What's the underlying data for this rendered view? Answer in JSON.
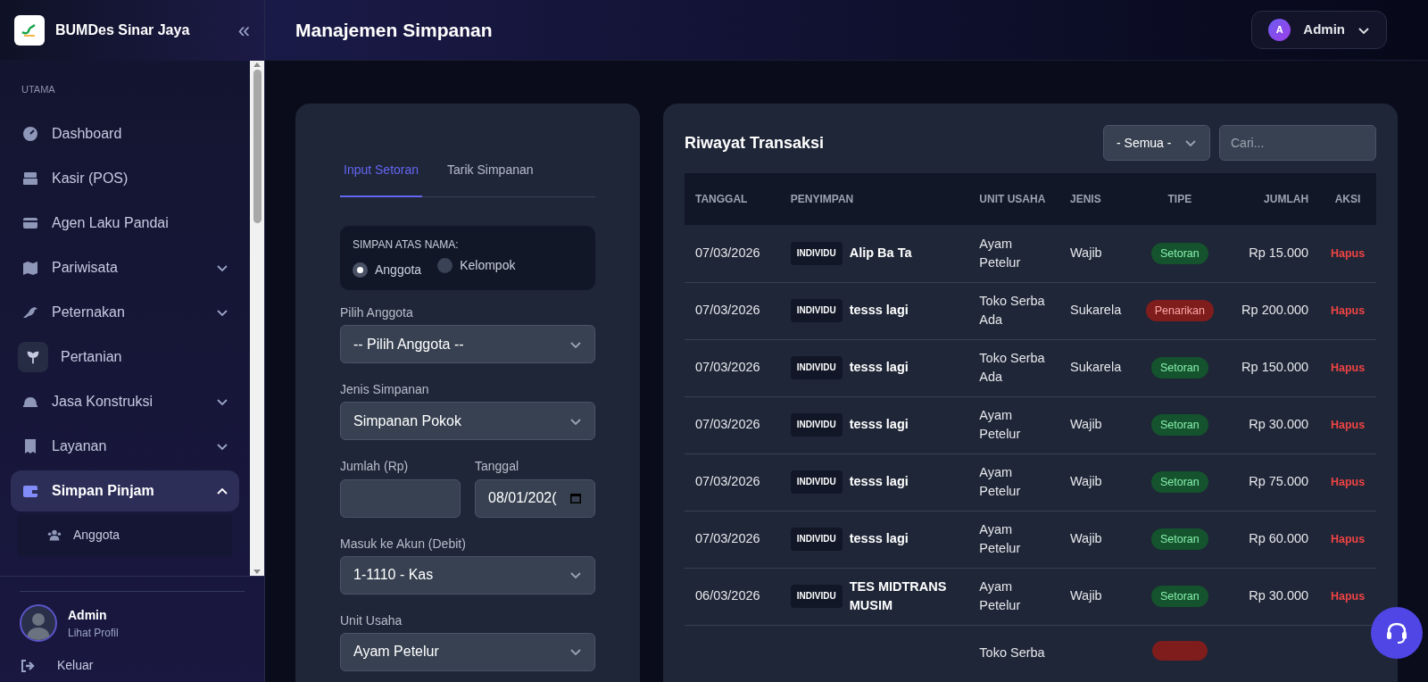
{
  "brand": {
    "name": "BUMDes Sinar Jaya",
    "collapse": "«"
  },
  "sidebar": {
    "section": "UTAMA",
    "items": [
      {
        "label": "Dashboard",
        "kind": "link",
        "selected": false
      },
      {
        "label": "Kasir (POS)",
        "kind": "link",
        "selected": false
      },
      {
        "label": "Agen Laku Pandai",
        "kind": "link",
        "selected": false
      },
      {
        "label": "Pariwisata",
        "kind": "group",
        "expanded": false,
        "selected": false
      },
      {
        "label": "Peternakan",
        "kind": "group",
        "expanded": false,
        "selected": false
      },
      {
        "label": "Pertanian",
        "kind": "boxed",
        "selected": false
      },
      {
        "label": "Jasa Konstruksi",
        "kind": "group",
        "expanded": false,
        "selected": false
      },
      {
        "label": "Layanan",
        "kind": "group",
        "expanded": false,
        "selected": false
      },
      {
        "label": "Simpan Pinjam",
        "kind": "group",
        "expanded": true,
        "selected": true,
        "children": [
          {
            "label": "Anggota"
          }
        ]
      }
    ],
    "user": {
      "name": "Admin",
      "link": "Lihat Profil"
    },
    "logout": "Keluar"
  },
  "header": {
    "title": "Manajemen Simpanan",
    "user": {
      "initial": "A",
      "name": "Admin"
    }
  },
  "form": {
    "tabs": [
      {
        "label": "Input Setoran",
        "selected": true
      },
      {
        "label": "Tarik Simpanan",
        "selected": false
      }
    ],
    "owner": {
      "title": "SIMPAN ATAS NAMA:",
      "options": [
        {
          "label": "Anggota",
          "selected": true
        },
        {
          "label": "Kelompok",
          "selected": false
        }
      ]
    },
    "fields": [
      {
        "label": "Pilih Anggota",
        "kind": "select",
        "value": "-- Pilih Anggota --"
      },
      {
        "label": "Jenis Simpanan",
        "kind": "select",
        "value": "Simpanan Pokok"
      },
      {
        "kind": "pair",
        "items": [
          {
            "label": "Jumlah (Rp)",
            "kind": "text"
          },
          {
            "label": "Tanggal",
            "kind": "date",
            "value": "08/01/202("
          }
        ]
      },
      {
        "label": "Masuk ke Akun (Debit)",
        "kind": "select",
        "value": "1-1110 - Kas"
      },
      {
        "label": "Unit Usaha",
        "kind": "select",
        "value": "Ayam Petelur"
      }
    ]
  },
  "history": {
    "title": "Riwayat Transaksi",
    "filter": "- Semua -",
    "search": {
      "placeholder": "Cari..."
    },
    "table": {
      "columns": [
        "TANGGAL",
        "PENYIMPAN",
        "UNIT USAHA",
        "JENIS",
        "TIPE",
        "JUMLAH",
        "AKSI"
      ],
      "rows": [
        {
          "tanggal": "07/03/2026",
          "badge": "INDIVIDU",
          "penyimpan": "Alip Ba Ta",
          "unit": "Ayam Petelur",
          "jenis": "Wajib",
          "tipe": {
            "label": "Setoran",
            "kind": "setoran"
          },
          "jumlah": "Rp 15.000",
          "aksi": "Hapus"
        },
        {
          "tanggal": "07/03/2026",
          "badge": "INDIVIDU",
          "penyimpan": "tesss lagi",
          "unit": "Toko Serba Ada",
          "jenis": "Sukarela",
          "tipe": {
            "label": "Penarikan",
            "kind": "penarikan"
          },
          "jumlah": "Rp 200.000",
          "aksi": "Hapus"
        },
        {
          "tanggal": "07/03/2026",
          "badge": "INDIVIDU",
          "penyimpan": "tesss lagi",
          "unit": "Toko Serba Ada",
          "jenis": "Sukarela",
          "tipe": {
            "label": "Setoran",
            "kind": "setoran"
          },
          "jumlah": "Rp 150.000",
          "aksi": "Hapus"
        },
        {
          "tanggal": "07/03/2026",
          "badge": "INDIVIDU",
          "penyimpan": "tesss lagi",
          "unit": "Ayam Petelur",
          "jenis": "Wajib",
          "tipe": {
            "label": "Setoran",
            "kind": "setoran"
          },
          "jumlah": "Rp 30.000",
          "aksi": "Hapus"
        },
        {
          "tanggal": "07/03/2026",
          "badge": "INDIVIDU",
          "penyimpan": "tesss lagi",
          "unit": "Ayam Petelur",
          "jenis": "Wajib",
          "tipe": {
            "label": "Setoran",
            "kind": "setoran"
          },
          "jumlah": "Rp 75.000",
          "aksi": "Hapus"
        },
        {
          "tanggal": "07/03/2026",
          "badge": "INDIVIDU",
          "penyimpan": "tesss lagi",
          "unit": "Ayam Petelur",
          "jenis": "Wajib",
          "tipe": {
            "label": "Setoran",
            "kind": "setoran"
          },
          "jumlah": "Rp 60.000",
          "aksi": "Hapus"
        },
        {
          "tanggal": "06/03/2026",
          "badge": "INDIVIDU",
          "penyimpan": "TES MIDTRANS MUSIM",
          "unit": "Ayam Petelur",
          "jenis": "Wajib",
          "tipe": {
            "label": "Setoran",
            "kind": "setoran"
          },
          "jumlah": "Rp 30.000",
          "aksi": "Hapus"
        },
        {
          "unit": "Toko Serba",
          "tipe": {
            "kind": "penarikan"
          }
        }
      ]
    }
  }
}
